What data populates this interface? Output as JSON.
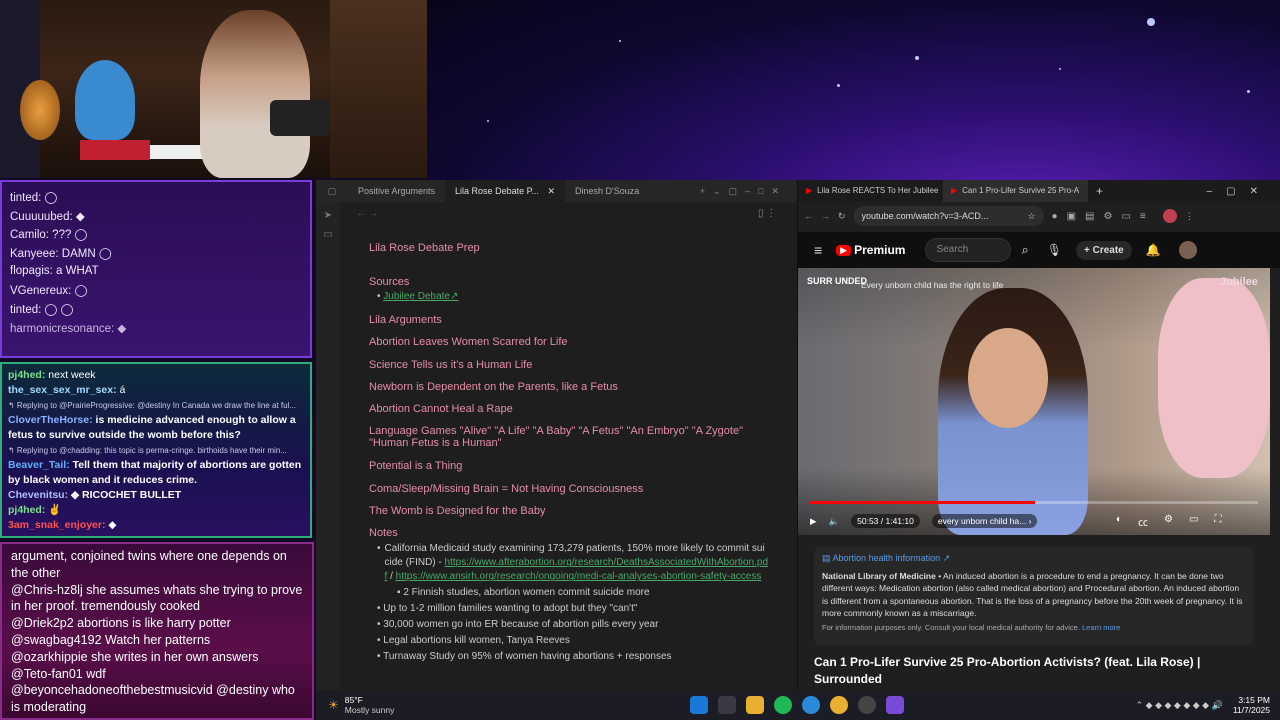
{
  "chat_top": {
    "lines": [
      "tinted: ◯",
      "Cuuuuubed: ◆",
      "Camilo: ??? ◯",
      "Kanyeee: DAMN ◯",
      "flopagis: a WHAT",
      "VGenereux: ◯",
      "tinted: ◯ ◯",
      "harmonicresonance: ◆"
    ]
  },
  "chat_mid": {
    "lines": [
      {
        "name": "pj4hed:",
        "text": "next week"
      },
      {
        "name": "the_sex_sex_mr_sex:",
        "text": "á"
      },
      {
        "reply": "↰ Replying to @PrairieProgressive: @destiny In Canada we draw the line at ful..."
      },
      {
        "name": "CloverTheHorse:",
        "text": "is medicine advanced enough to allow a fetus to survive outside the womb before this?"
      },
      {
        "reply": "↰ Replying to @chadding: this topic is perma-cringe. birthoids have their min..."
      },
      {
        "name": "Beaver_Tail:",
        "text": "Tell them that majority of abortions are gotten by black women and it reduces crime."
      },
      {
        "name": "Chevenitsu:",
        "text": "◆ RICOCHET BULLET"
      },
      {
        "name": "pj4hed:",
        "text": "✌"
      },
      {
        "name": "3am_snak_enjoyer:",
        "text": "◆"
      }
    ]
  },
  "chat_bottom": {
    "lines": [
      "argument, conjoined twins where one depends on the other",
      "@Chris-hz8lj she assumes whats she trying to prove in her proof. tremendously cooked",
      "@Driek2p2 abortions is like harry potter",
      "@swagbag4192 Watch her patterns",
      "@ozarkhippie she writes in her own answers",
      "@Teto-fan01 wdf",
      "@beyoncehadoneofthebestmusicvid @destiny who is moderating"
    ]
  },
  "notes": {
    "tabs": [
      "Positive Arguments",
      "Lila Rose Debate P...",
      "Dinesh D'Souza"
    ],
    "title": "Lila Rose Debate Prep",
    "sources_heading": "Sources",
    "sources_link": "Jubilee Debate",
    "arguments_heading": "Lila Arguments",
    "arguments": [
      "Abortion Leaves Women Scarred for Life",
      "Science Tells us it's a Human Life",
      "Newborn is Dependent on the Parents, like a Fetus",
      "Abortion Cannot Heal a Rape",
      "Language Games \"Alive\" \"A Life\" \"A Baby\" \"A Fetus\" \"An Embryo\" \"A Zygote\" \"Human Fetus is a Human\"",
      "Potential is a Thing",
      "Coma/Sleep/Missing Brain = Not Having Consciousness",
      "The Womb is Designed for the Baby"
    ],
    "notes_heading": "Notes",
    "note1_text": "California Medicaid study examining 173,279 patients, 150% more likely to commit suicide (FIND) - ",
    "note1_link1": "https://www.afterabortion.org/research/DeathsAssociatedWithAbortion.pdf",
    "note1_sep": " / ",
    "note1_link2": "https://www.ansirh.org/research/ongoing/medi-cal-analyses-abortion-safety-access",
    "note1_sub": "2 Finnish studies, abortion women commit suicide more",
    "note2": "Up to 1-2 million families wanting to adopt but they \"can't\"",
    "note3": "30,000 women go into ER because of abortion pills every year",
    "note4": "Legal abortions kill women, Tanya Reeves",
    "note5": "Turnaway Study on 95% of women having abortions + responses"
  },
  "browser": {
    "tabs": [
      "Lila Rose REACTS To Her Jubilee",
      "Can 1 Pro-Lifer Survive 25 Pro-A"
    ],
    "url": "youtube.com/watch?v=3-ACD...",
    "premium_label": "Premium",
    "search_placeholder": "Search",
    "create_label": "Create",
    "video_overlay_brand": "SURR UNDED",
    "video_overlay_text": "Every unborn child has the right to life",
    "video_brand_right": "Jubilee",
    "time": "50:53 / 1:41:10",
    "chapter": "every unborn child ha...",
    "progress_fraction": 0.503,
    "info_header": "Abortion health information ↗",
    "info_source": "National Library of Medicine",
    "info_text": " • An induced abortion is a procedure to end a pregnancy. It can be done two different ways: Medication abortion (also called medical abortion) and Procedural abortion. An induced abortion is different from a spontaneous abortion. That is the loss of a pregnancy before the 20th week of pregnancy. It is more commonly known as a miscarriage.",
    "info_footer": "For information purposes only. Consult your local medical authority for advice.",
    "learn_more": "Learn more",
    "video_title": "Can 1 Pro-Lifer Survive 25 Pro-Abortion Activists? (feat. Lila Rose) | Surrounded"
  },
  "taskbar": {
    "temp": "85°F",
    "weather": "Mostly sunny",
    "time": "3:15 PM",
    "date": "11/7/2025"
  },
  "colors": {
    "heading": "#e58ea5",
    "link": "#4aa867",
    "yt_red": "#ff0000",
    "accent_purple": "#7a3cd6"
  }
}
